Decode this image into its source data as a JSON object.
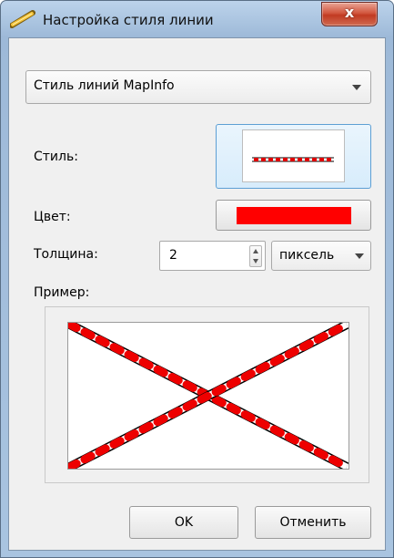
{
  "window": {
    "title": "Настройка стиля линии",
    "close_glyph": "x",
    "title_icon": "pencil-icon"
  },
  "style_set_combo": {
    "value": "Стиль линий MapInfo",
    "arrow_icon": "chevron-down-icon"
  },
  "style_row": {
    "label": "Стиль:",
    "line_pattern": "dotted-red-line"
  },
  "color_row": {
    "label": "Цвет:",
    "color": "#ff0000"
  },
  "thickness_row": {
    "label": "Толщина:",
    "value": "2",
    "unit": "пиксель"
  },
  "preview": {
    "label": "Пример:"
  },
  "buttons": {
    "ok": "OK",
    "cancel": "Отменить"
  }
}
